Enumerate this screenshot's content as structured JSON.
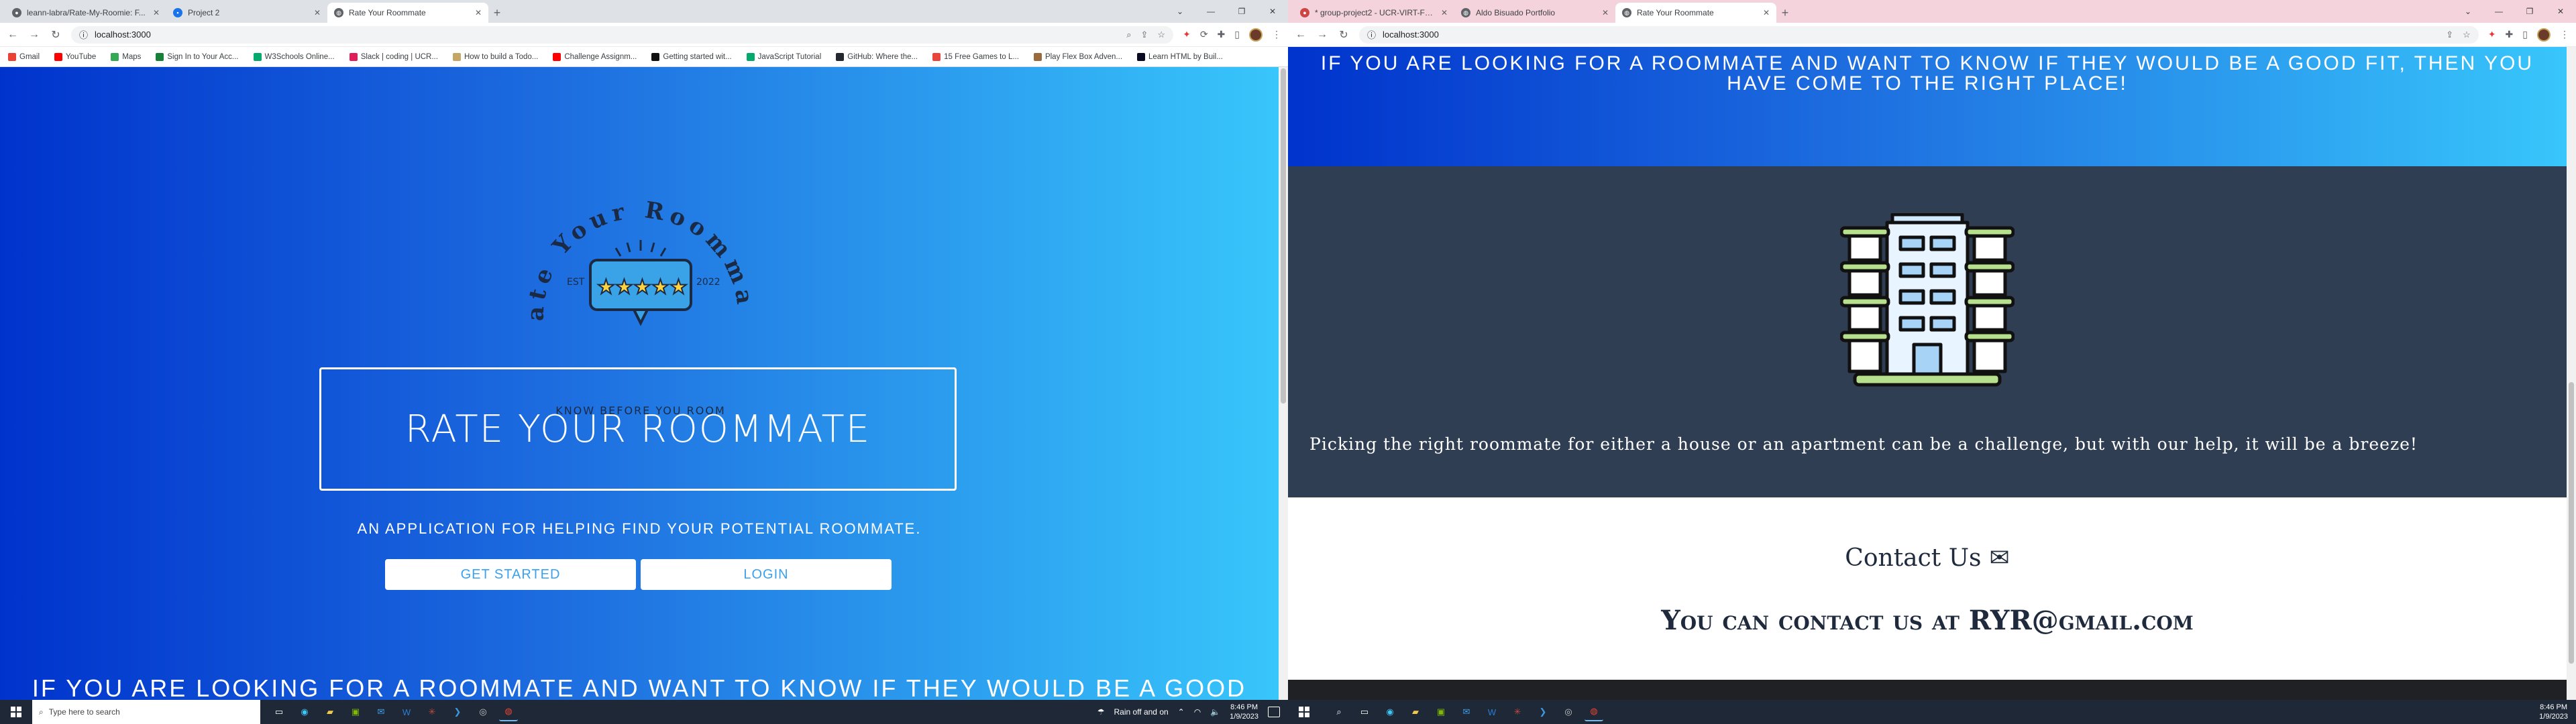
{
  "left": {
    "tabs": [
      {
        "title": "leann-labra/Rate-My-Roomie: F...",
        "favicon": "github-icon",
        "active": false
      },
      {
        "title": "Project 2",
        "favicon": "project-icon",
        "active": false
      },
      {
        "title": "Rate Your Roommate",
        "favicon": "globe-icon",
        "active": true
      }
    ],
    "url": "localhost:3000",
    "bookmarks": [
      {
        "label": "Gmail",
        "color": "#ea4335"
      },
      {
        "label": "YouTube",
        "color": "#ff0000"
      },
      {
        "label": "Maps",
        "color": "#34a853"
      },
      {
        "label": "Sign In to Your Acc...",
        "color": "#188038"
      },
      {
        "label": "W3Schools Online...",
        "color": "#04aa6d"
      },
      {
        "label": "Slack | coding | UCR...",
        "color": "#e01e5a"
      },
      {
        "label": "How to build a Todo...",
        "color": "#c6a664"
      },
      {
        "label": "Challenge Assignm...",
        "color": "#ff0000"
      },
      {
        "label": "Getting started wit...",
        "color": "#111111"
      },
      {
        "label": "JavaScript Tutorial",
        "color": "#04aa6d"
      },
      {
        "label": "GitHub: Where the...",
        "color": "#24292f"
      },
      {
        "label": "15 Free Games to L...",
        "color": "#e8453c"
      },
      {
        "label": "Play Flex Box Adven...",
        "color": "#9b6a3c"
      },
      {
        "label": "Learn HTML by Buil...",
        "color": "#0a0a23"
      }
    ],
    "logo": {
      "arc_text": "Rate Your Roommate",
      "est": "EST",
      "year": "2022",
      "motto": "KNOW BEFORE YOU ROOM"
    },
    "hero_title": "RATE YOUR ROOMMATE",
    "tagline": "AN APPLICATION FOR HELPING FIND YOUR POTENTIAL ROOMMATE.",
    "get_started": "GET STARTED",
    "login": "LOGIN",
    "bottom_text": "IF YOU ARE LOOKING FOR A ROOMMATE AND WANT TO KNOW IF THEY WOULD BE A GOOD"
  },
  "right": {
    "tabs": [
      {
        "title": "* group-project2 - UCR-VIRT-FS...",
        "favicon": "project-icon",
        "active": false
      },
      {
        "title": "Aldo Bisuado Portfolio",
        "favicon": "globe-icon",
        "active": false
      },
      {
        "title": "Rate Your Roommate",
        "favicon": "globe-icon",
        "active": true
      }
    ],
    "url": "localhost:3000",
    "intro": "IF YOU ARE LOOKING FOR A ROOMMATE AND WANT TO KNOW IF THEY WOULD BE A GOOD FIT, THEN YOU HAVE COME TO THE RIGHT PLACE!",
    "picking": "Picking the right roommate for either a house or an apartment can be a challenge, but with our help, it will be a breeze!",
    "contact_heading": "Contact Us",
    "contact_line": "You can contact us at RYR@gmail.com"
  },
  "taskbar_left": {
    "search_placeholder": "Type here to search",
    "weather": "Rain off and on",
    "time": "8:46 PM",
    "date": "1/9/2023"
  },
  "taskbar_right": {
    "time": "8:46 PM",
    "date": "1/9/2023"
  },
  "colors": {
    "gradient_start": "#0033cc",
    "gradient_end": "#38c6fb",
    "dark_band": "#2f3e52",
    "contact_text": "#1f2b3d"
  }
}
